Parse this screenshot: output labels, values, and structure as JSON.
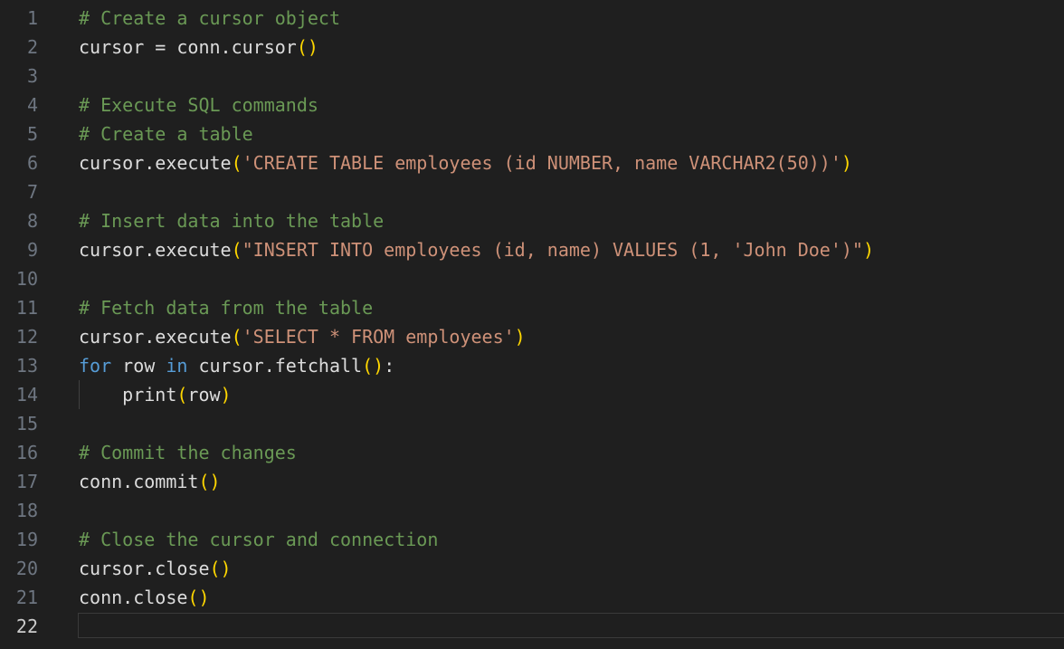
{
  "editor": {
    "colors": {
      "background": "#1f1f1f",
      "comment": "#6a9955",
      "plain": "#dcdcdc",
      "bracket": "#ffd700",
      "string": "#ce9178",
      "keyword": "#569cd6",
      "line_number": "#6e7681",
      "current_line_number": "#cccccc"
    },
    "current_line": 22,
    "lines": [
      {
        "n": "1",
        "tokens": [
          {
            "t": "comment",
            "v": "# Create a cursor object"
          }
        ]
      },
      {
        "n": "2",
        "tokens": [
          {
            "t": "plain",
            "v": "cursor = conn.cursor"
          },
          {
            "t": "bracket",
            "v": "()"
          }
        ]
      },
      {
        "n": "3",
        "tokens": []
      },
      {
        "n": "4",
        "tokens": [
          {
            "t": "comment",
            "v": "# Execute SQL commands"
          }
        ]
      },
      {
        "n": "5",
        "tokens": [
          {
            "t": "comment",
            "v": "# Create a table"
          }
        ]
      },
      {
        "n": "6",
        "tokens": [
          {
            "t": "plain",
            "v": "cursor.execute"
          },
          {
            "t": "bracket",
            "v": "("
          },
          {
            "t": "string",
            "v": "'CREATE TABLE employees (id NUMBER, name VARCHAR2(50))'"
          },
          {
            "t": "bracket",
            "v": ")"
          }
        ]
      },
      {
        "n": "7",
        "tokens": []
      },
      {
        "n": "8",
        "tokens": [
          {
            "t": "comment",
            "v": "# Insert data into the table"
          }
        ]
      },
      {
        "n": "9",
        "tokens": [
          {
            "t": "plain",
            "v": "cursor.execute"
          },
          {
            "t": "bracket",
            "v": "("
          },
          {
            "t": "string",
            "v": "\"INSERT INTO employees (id, name) VALUES (1, 'John Doe')\""
          },
          {
            "t": "bracket",
            "v": ")"
          }
        ]
      },
      {
        "n": "10",
        "tokens": []
      },
      {
        "n": "11",
        "tokens": [
          {
            "t": "comment",
            "v": "# Fetch data from the table"
          }
        ]
      },
      {
        "n": "12",
        "tokens": [
          {
            "t": "plain",
            "v": "cursor.execute"
          },
          {
            "t": "bracket",
            "v": "("
          },
          {
            "t": "string",
            "v": "'SELECT * FROM employees'"
          },
          {
            "t": "bracket",
            "v": ")"
          }
        ]
      },
      {
        "n": "13",
        "tokens": [
          {
            "t": "keyword",
            "v": "for"
          },
          {
            "t": "plain",
            "v": " row "
          },
          {
            "t": "keyword",
            "v": "in"
          },
          {
            "t": "plain",
            "v": " cursor.fetchall"
          },
          {
            "t": "bracket",
            "v": "()"
          },
          {
            "t": "plain",
            "v": ":"
          }
        ]
      },
      {
        "n": "14",
        "indent": true,
        "tokens": [
          {
            "t": "plain",
            "v": "    print"
          },
          {
            "t": "bracket",
            "v": "("
          },
          {
            "t": "plain",
            "v": "row"
          },
          {
            "t": "bracket",
            "v": ")"
          }
        ]
      },
      {
        "n": "15",
        "tokens": []
      },
      {
        "n": "16",
        "tokens": [
          {
            "t": "comment",
            "v": "# Commit the changes"
          }
        ]
      },
      {
        "n": "17",
        "tokens": [
          {
            "t": "plain",
            "v": "conn.commit"
          },
          {
            "t": "bracket",
            "v": "()"
          }
        ]
      },
      {
        "n": "18",
        "tokens": []
      },
      {
        "n": "19",
        "tokens": [
          {
            "t": "comment",
            "v": "# Close the cursor and connection"
          }
        ]
      },
      {
        "n": "20",
        "tokens": [
          {
            "t": "plain",
            "v": "cursor.close"
          },
          {
            "t": "bracket",
            "v": "()"
          }
        ]
      },
      {
        "n": "21",
        "tokens": [
          {
            "t": "plain",
            "v": "conn.close"
          },
          {
            "t": "bracket",
            "v": "()"
          }
        ]
      },
      {
        "n": "22",
        "tokens": []
      }
    ]
  }
}
